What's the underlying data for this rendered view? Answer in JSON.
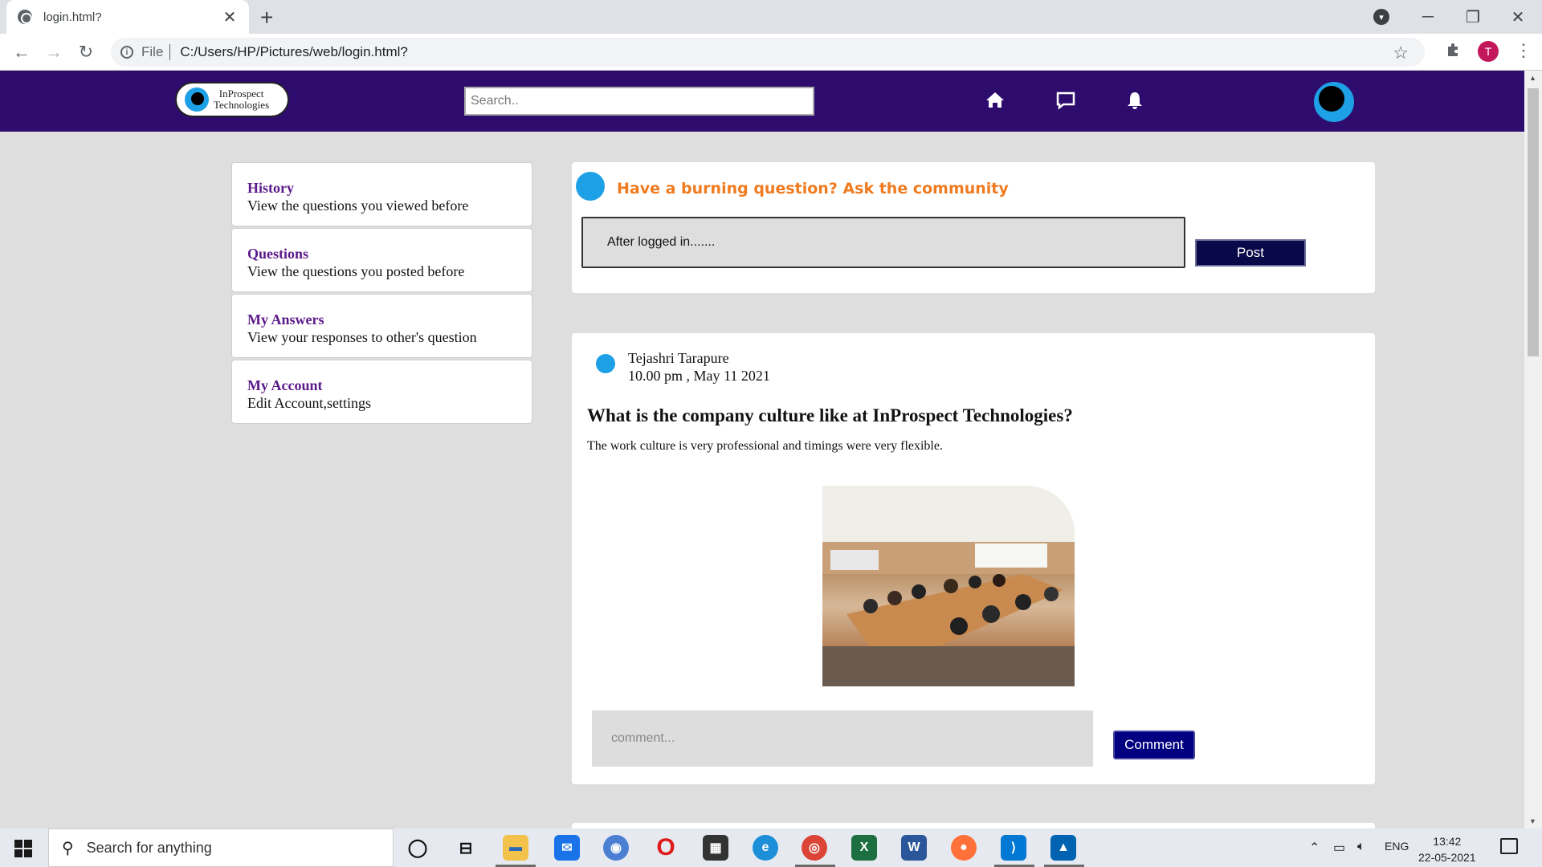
{
  "browser": {
    "tab_title": "login.html?",
    "tab_close": "✕",
    "new_tab": "+",
    "file_label": "File",
    "url": "C:/Users/HP/Pictures/web/login.html?",
    "profile_initial": "T"
  },
  "site": {
    "logo_line1": "InProspect",
    "logo_line2": "Technologies",
    "search_placeholder": "Search..",
    "icons": [
      "home-icon",
      "chat-icon",
      "bell-icon"
    ]
  },
  "sidebar": {
    "items": [
      {
        "title": "History",
        "desc": "View the questions you viewed before"
      },
      {
        "title": "Questions",
        "desc": "View the questions you posted before"
      },
      {
        "title": "My Answers",
        "desc": "View your responses to other's question"
      },
      {
        "title": "My Account",
        "desc": "Edit Account,settings"
      }
    ]
  },
  "ask": {
    "heading": "Have a burning question? Ask the community",
    "input_value": "After logged in.......",
    "post_label": "Post"
  },
  "post": {
    "author": "Tejashri Tarapure",
    "timestamp": "10.00 pm , May 11 2021",
    "title": "What is the company culture like at InProspect Technologies?",
    "body": "The work culture is very professional and timings were very flexible.",
    "comment_placeholder": "comment...",
    "comment_label": "Comment"
  },
  "taskbar": {
    "search_text": "Search for anything",
    "apps": [
      "cortana",
      "task-view",
      "file-explorer",
      "mail",
      "chromium",
      "opera",
      "store",
      "edge",
      "chrome",
      "excel",
      "word",
      "firefox",
      "vscode",
      "photos"
    ],
    "lang": "ENG",
    "time": "13:42",
    "date": "22-05-2021"
  },
  "colors": {
    "header_bg": "#2e0c6e",
    "accent_orange": "#f07a1e",
    "sidebar_title": "#5b1a8a",
    "post_btn": "#090849",
    "comment_btn": "#000080"
  }
}
